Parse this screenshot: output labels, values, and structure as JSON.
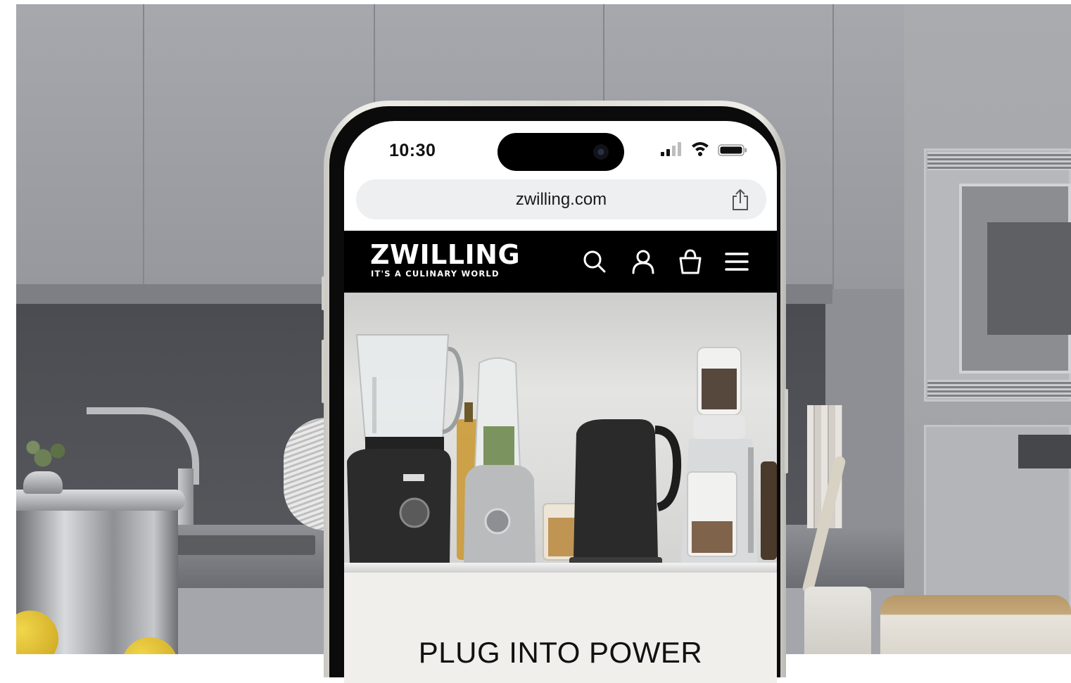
{
  "status_bar": {
    "time": "10:30",
    "icons": [
      "signal-icon",
      "wifi-icon",
      "battery-icon"
    ]
  },
  "browser": {
    "url": "zwilling.com",
    "icons": [
      "share-icon"
    ]
  },
  "site_header": {
    "logo_word": "ZWILLING",
    "logo_tagline": "IT'S A CULINARY WORLD",
    "icons": [
      "search-icon",
      "account-icon",
      "shopping-bag-icon",
      "hamburger-menu-icon"
    ],
    "background_color": "#000000",
    "foreground_color": "#ffffff"
  },
  "hero": {
    "title": "PLUG INTO POWER",
    "image_subject": "ZWILLING kitchen appliances on a counter"
  },
  "colors": {
    "phone_frame": "#e6e4de",
    "url_bar": "#eeeff1",
    "title_band": "#f1efec"
  }
}
